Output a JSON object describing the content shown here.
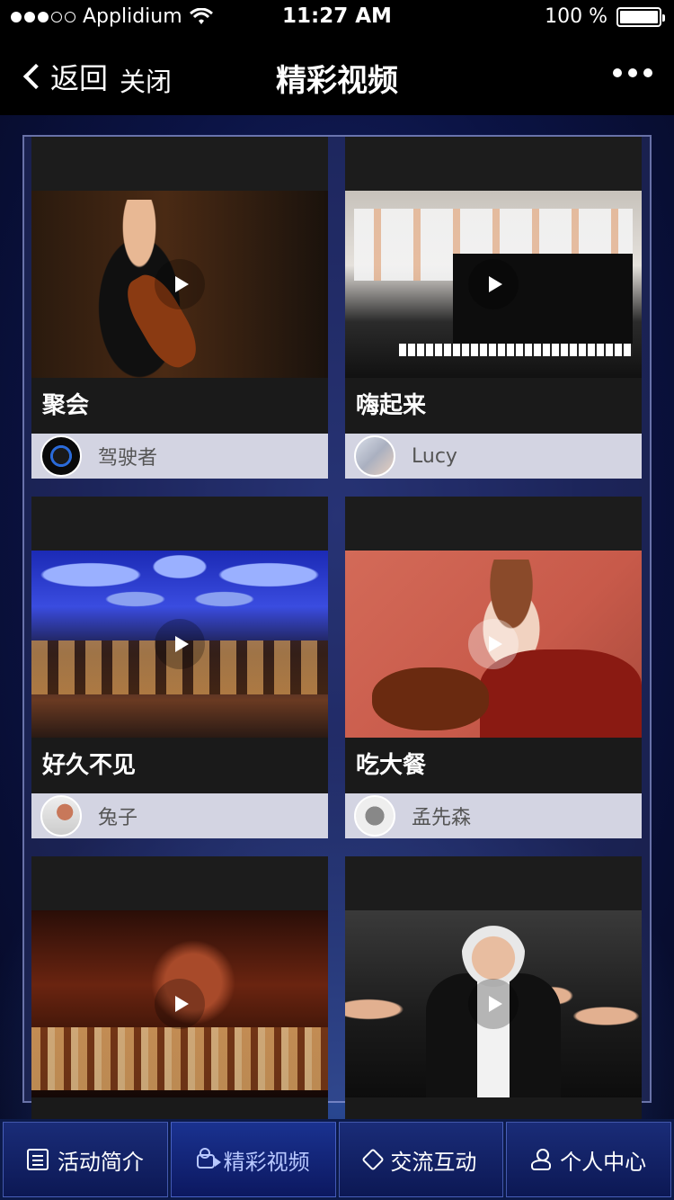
{
  "status_bar": {
    "carrier": "Applidium",
    "time": "11:27 AM",
    "battery_label": "100 %",
    "battery_level": 1.0
  },
  "nav": {
    "back_label": "返回",
    "close_label": "关闭",
    "title": "精彩视频"
  },
  "videos": [
    {
      "title": "聚会",
      "author": "驾驶者"
    },
    {
      "title": "嗨起来",
      "author": "Lucy"
    },
    {
      "title": "好久不见",
      "author": "兔子"
    },
    {
      "title": "吃大餐",
      "author": "孟先森"
    },
    {
      "title": "",
      "author": ""
    },
    {
      "title": "",
      "author": ""
    }
  ],
  "tabs": [
    {
      "label": "活动简介",
      "icon": "list-icon",
      "active": false
    },
    {
      "label": "精彩视频",
      "icon": "video-camera-icon",
      "active": true
    },
    {
      "label": "交流互动",
      "icon": "handshake-icon",
      "active": false
    },
    {
      "label": "个人中心",
      "icon": "user-icon",
      "active": false
    }
  ],
  "colors": {
    "background": "#0b1344",
    "tab_bar": "#0c1a4a",
    "author_bar": "#d3d4e2",
    "active_tab_text": "#b8c8ff"
  }
}
